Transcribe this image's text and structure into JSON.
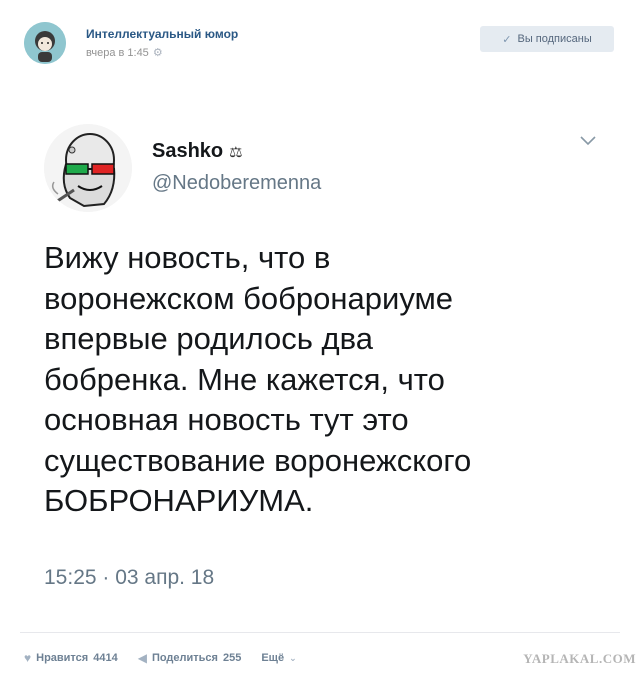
{
  "group": {
    "name": "Интеллектуальный юмор",
    "time": "вчера в 1:45",
    "subscribe_label": "Вы подписаны"
  },
  "tweet": {
    "display_name": "Sashko",
    "badge": "⚖",
    "handle": "@Nedoberemenna",
    "lines": [
      "Вижу новость, что в",
      "воронежском бобронариуме",
      "впервые родилось два",
      "бобренка. Мне кажется, что",
      "основная новость тут это",
      "существование воронежского",
      "БОБРОНАРИУМА."
    ],
    "date": "15:25 · 03 апр. 18"
  },
  "footer": {
    "like_label": "Нравится",
    "like_count": "4414",
    "share_label": "Поделиться",
    "share_count": "255",
    "more_label": "Ещё"
  },
  "watermark": "YAPLAKAL.COM",
  "colors": {
    "link": "#2a5885",
    "muted": "#939393",
    "tweet_text": "#14171a",
    "tweet_muted": "#657786",
    "button_bg": "#e5ebf1"
  }
}
